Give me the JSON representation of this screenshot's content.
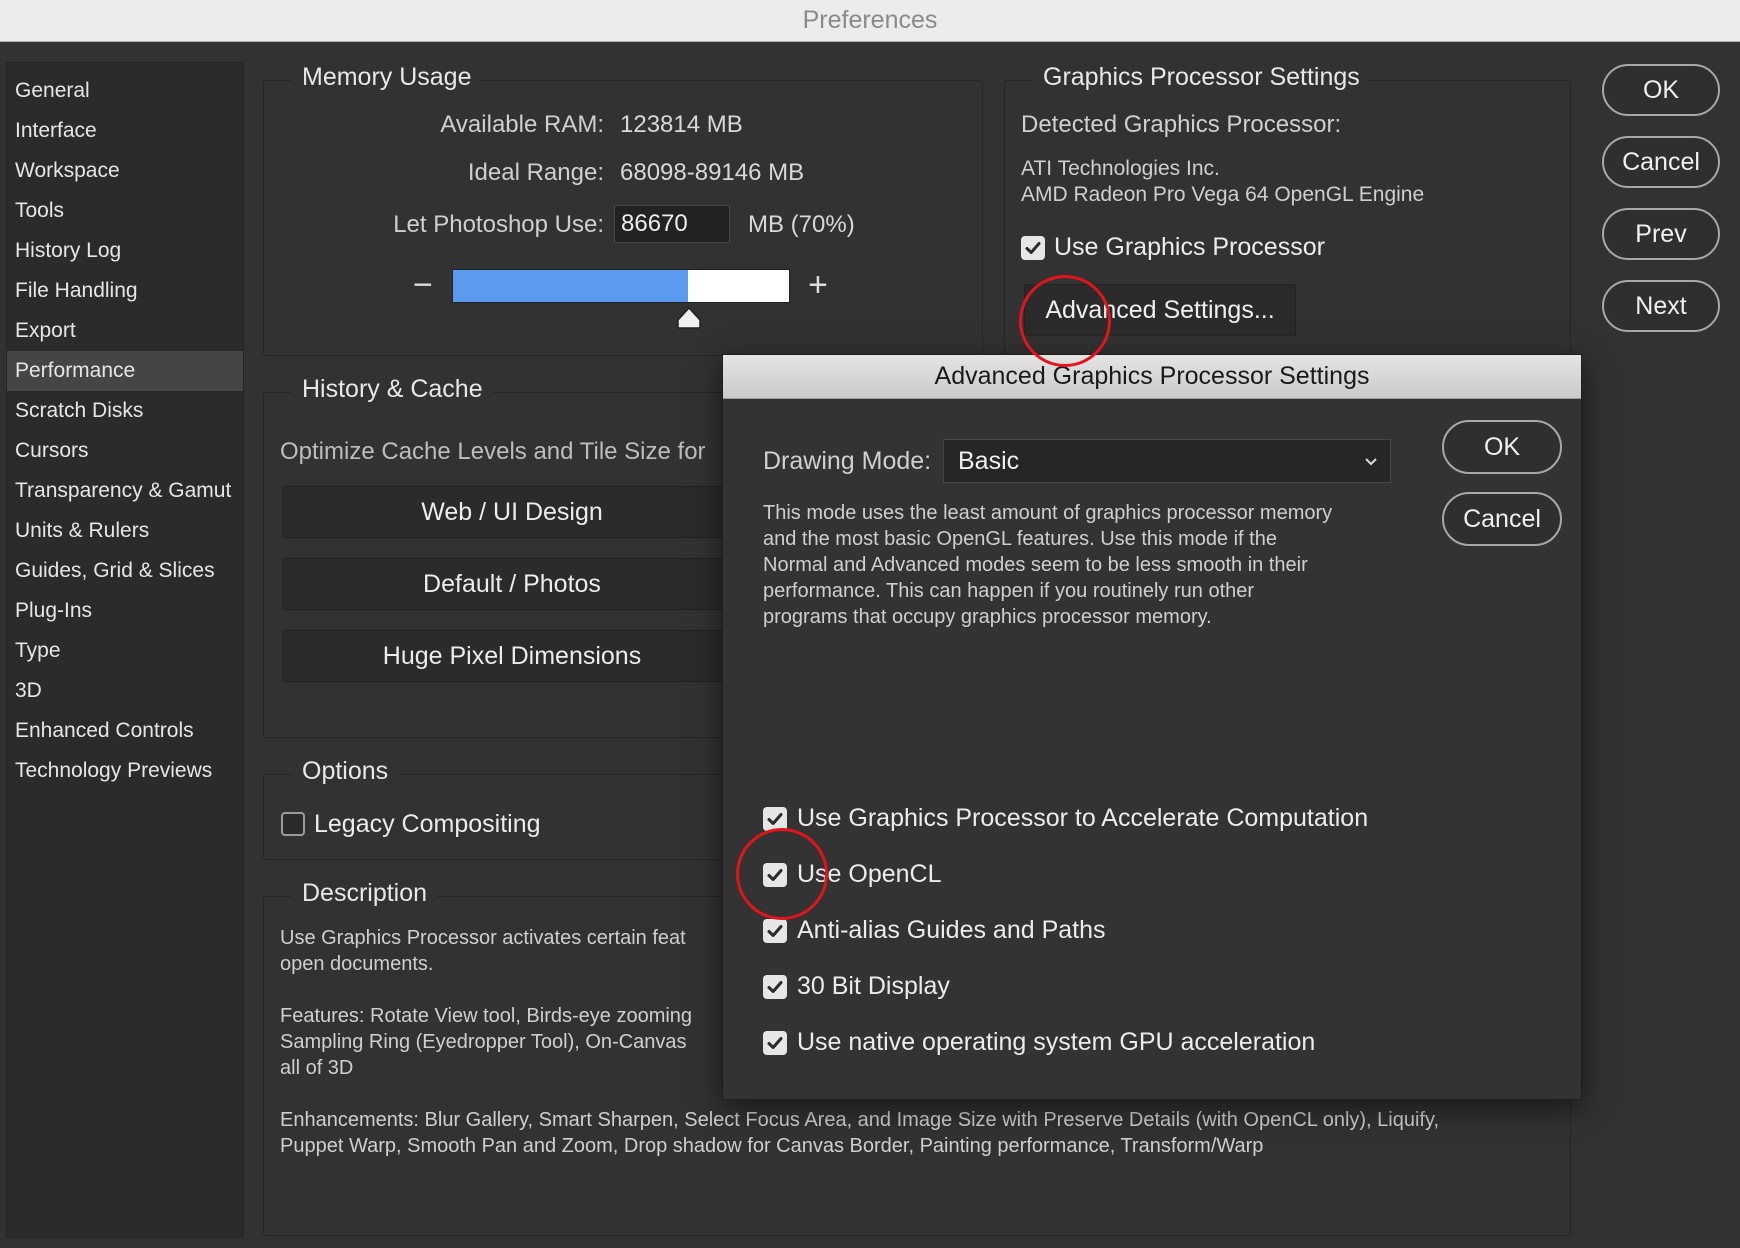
{
  "window": {
    "title": "Preferences"
  },
  "sidebar": {
    "items": [
      {
        "label": "General"
      },
      {
        "label": "Interface"
      },
      {
        "label": "Workspace"
      },
      {
        "label": "Tools"
      },
      {
        "label": "History Log"
      },
      {
        "label": "File Handling"
      },
      {
        "label": "Export"
      },
      {
        "label": "Performance",
        "active": true
      },
      {
        "label": "Scratch Disks"
      },
      {
        "label": "Cursors"
      },
      {
        "label": "Transparency & Gamut"
      },
      {
        "label": "Units & Rulers"
      },
      {
        "label": "Guides, Grid & Slices"
      },
      {
        "label": "Plug-Ins"
      },
      {
        "label": "Type"
      },
      {
        "label": "3D"
      },
      {
        "label": "Enhanced Controls"
      },
      {
        "label": "Technology Previews"
      }
    ]
  },
  "memory": {
    "title": "Memory Usage",
    "available_label": "Available RAM:",
    "available_value": "123814 MB",
    "ideal_label": "Ideal Range:",
    "ideal_value": "68098-89146 MB",
    "use_label": "Let Photoshop Use:",
    "use_value": "86670",
    "use_suffix": "MB (70%)",
    "minus": "−",
    "plus": "+",
    "slider_fraction": 0.7
  },
  "history_cache": {
    "title": "History & Cache",
    "optimize_label": "Optimize Cache Levels and Tile Size for",
    "buttons": [
      "Web / UI Design",
      "Default / Photos",
      "Huge Pixel Dimensions"
    ]
  },
  "options": {
    "title": "Options",
    "legacy_label": "Legacy Compositing",
    "legacy_checked": false
  },
  "description": {
    "title": "Description",
    "para1": "Use Graphics Processor activates certain feat",
    "para1b": "open documents.",
    "para2a": "Features: Rotate View tool, Birds-eye zooming",
    "para2b": "Sampling Ring (Eyedropper Tool), On-Canvas",
    "para2c": "all of 3D",
    "para3a": "Enhancements: Blur Gallery, Smart Sharpen, Select Focus Area, and Image Size with Preserve Details (with OpenCL only), Liquify,",
    "para3b": "Puppet Warp, Smooth Pan and Zoom, Drop shadow for Canvas Border, Painting performance, Transform/Warp"
  },
  "gpu": {
    "title": "Graphics Processor Settings",
    "detected_label": "Detected Graphics Processor:",
    "vendor": "ATI Technologies Inc.",
    "model": "AMD Radeon Pro Vega 64 OpenGL Engine",
    "use_label": "Use Graphics Processor",
    "use_checked": true,
    "advanced_button": "Advanced Settings..."
  },
  "main_buttons": {
    "ok": "OK",
    "cancel": "Cancel",
    "prev": "Prev",
    "next": "Next"
  },
  "dialog": {
    "title": "Advanced Graphics Processor Settings",
    "drawing_mode_label": "Drawing Mode:",
    "drawing_mode_value": "Basic",
    "mode_desc": [
      "This mode uses the least amount of graphics processor memory",
      "and the most basic OpenGL features.  Use this mode if the",
      "Normal and Advanced modes seem to be less smooth in their",
      "performance.  This can happen if you routinely run other",
      "programs that occupy graphics processor memory."
    ],
    "ok": "OK",
    "cancel": "Cancel",
    "checkboxes": [
      {
        "label": "Use Graphics Processor to Accelerate Computation",
        "checked": true
      },
      {
        "label": "Use OpenCL",
        "checked": true
      },
      {
        "label": "Anti-alias Guides and Paths",
        "checked": true
      },
      {
        "label": "30 Bit Display",
        "checked": true
      },
      {
        "label": "Use native operating system GPU acceleration",
        "checked": true
      }
    ]
  },
  "colors": {
    "background": "#323232",
    "slider_fill": "#5b9aef",
    "highlight_circle": "#e3141b"
  }
}
